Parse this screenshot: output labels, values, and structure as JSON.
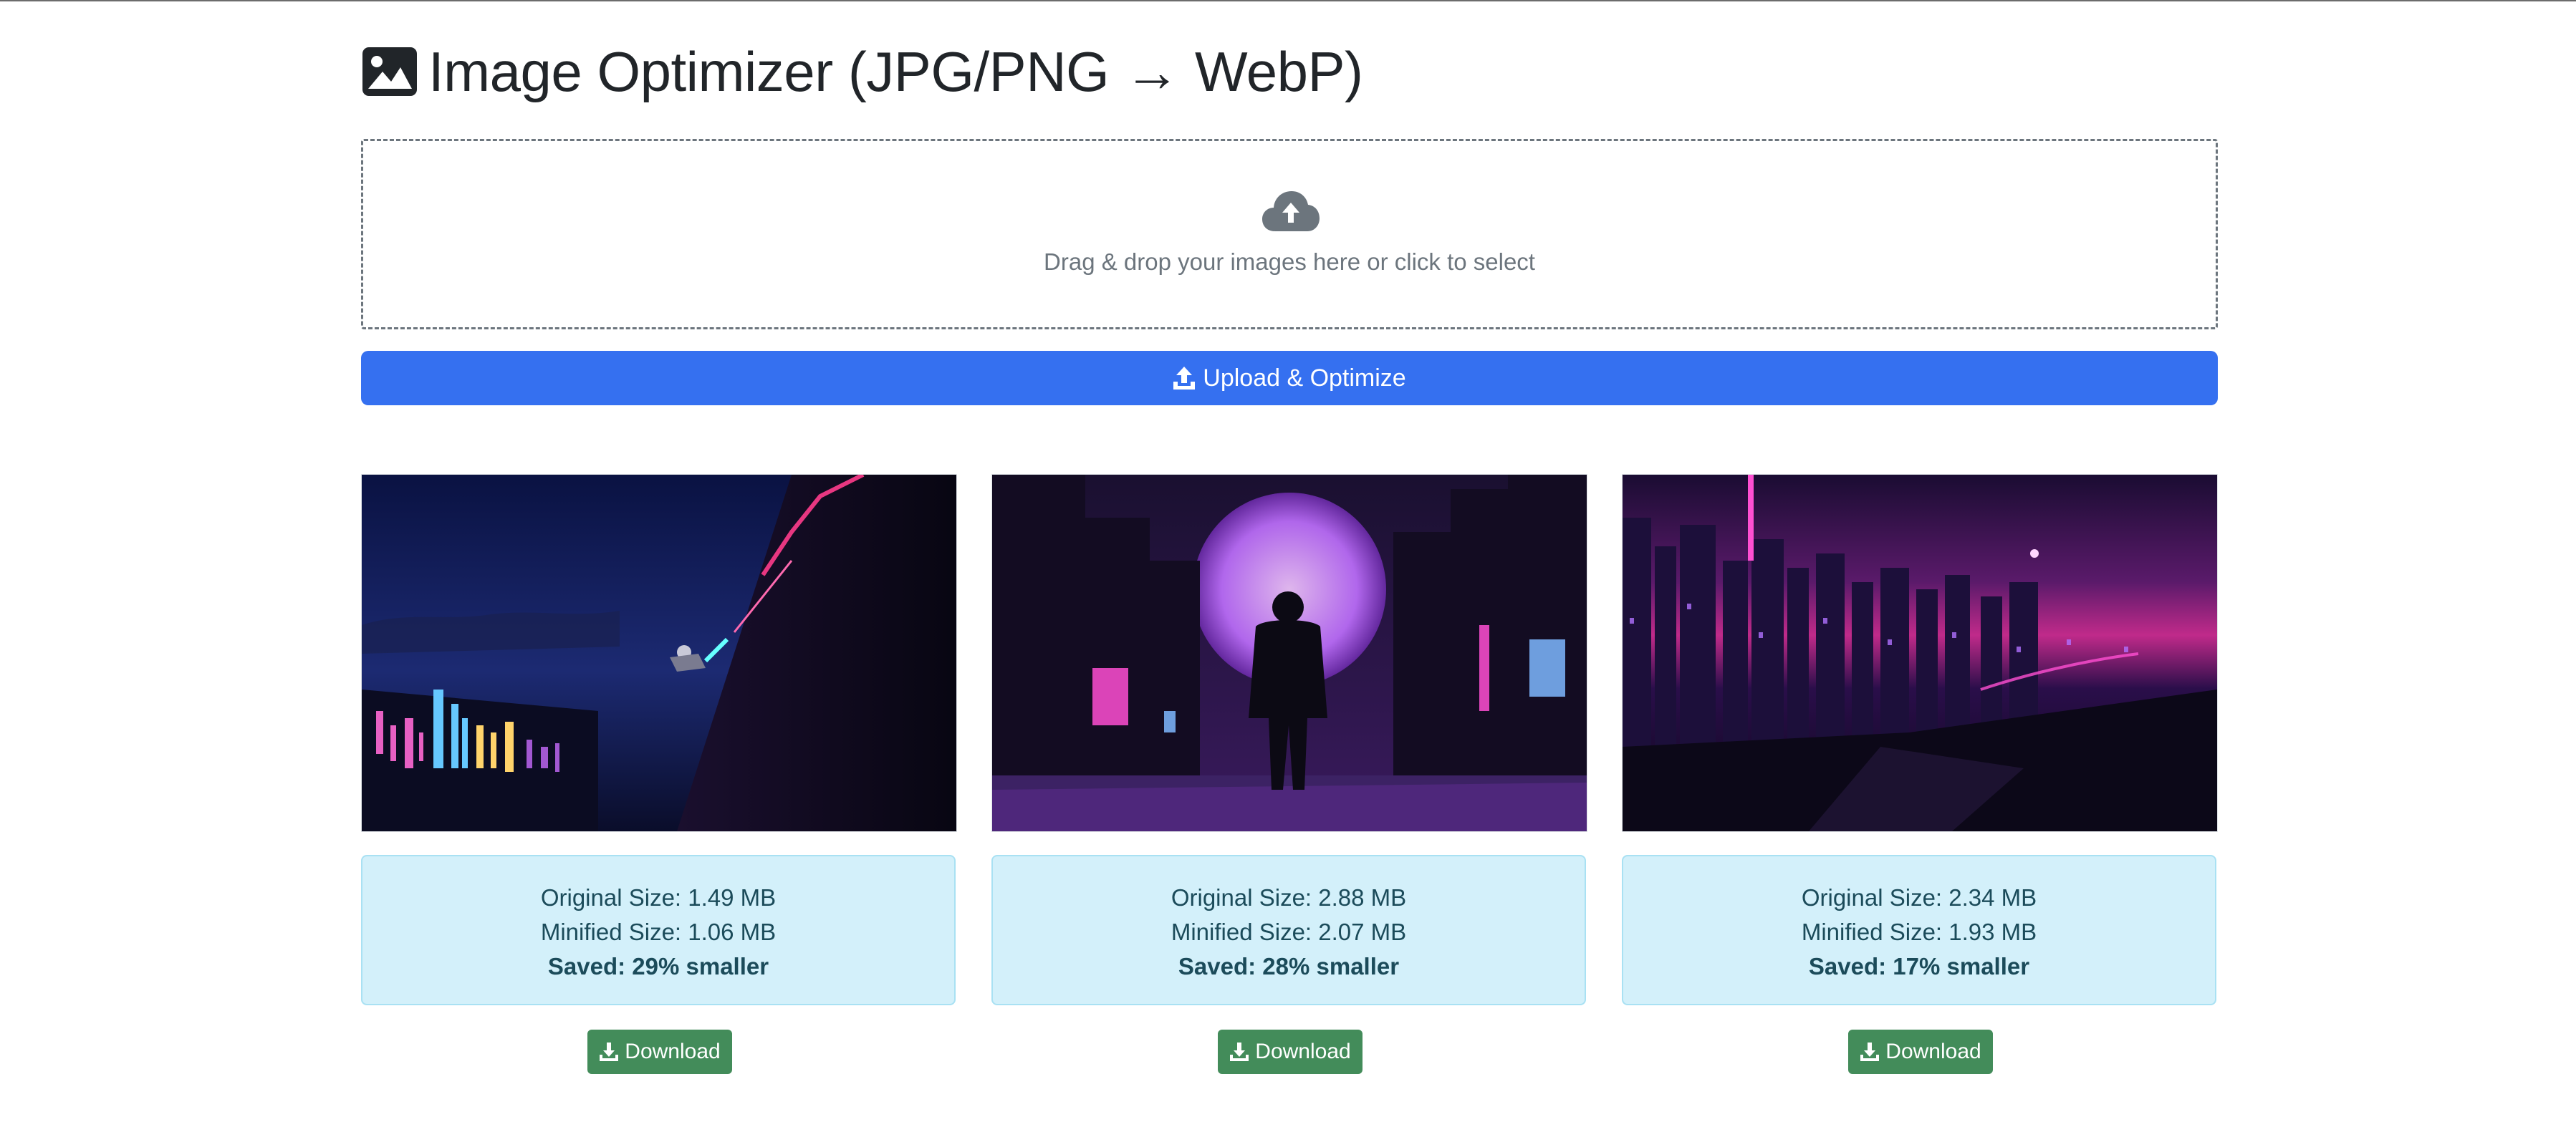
{
  "page": {
    "title": "Image Optimizer (JPG/PNG → WebP)",
    "title_icon": "image-icon"
  },
  "dropzone": {
    "icon": "cloud-upload-icon",
    "text": "Drag & drop your images here or click to select"
  },
  "upload_button": {
    "icon": "upload-icon",
    "label": "Upload & Optimize"
  },
  "results": [
    {
      "image_alt": "cyberpunk night city with climber",
      "original": "Original Size: 1.49 MB",
      "minified": "Minified Size: 1.06 MB",
      "saved": "Saved: 29% smaller",
      "download_label": "Download"
    },
    {
      "image_alt": "figure before purple moon city",
      "original": "Original Size: 2.88 MB",
      "minified": "Minified Size: 2.07 MB",
      "saved": "Saved: 28% smaller",
      "download_label": "Download"
    },
    {
      "image_alt": "neon city skyline",
      "original": "Original Size: 2.34 MB",
      "minified": "Minified Size: 1.93 MB",
      "saved": "Saved: 17% smaller",
      "download_label": "Download"
    }
  ],
  "colors": {
    "primary": "#3570f0",
    "success": "#438c5a",
    "info_bg": "#d3f0fa",
    "info_border": "#a9e1f3",
    "info_text": "#1b4b5a",
    "muted": "#6c757d"
  }
}
